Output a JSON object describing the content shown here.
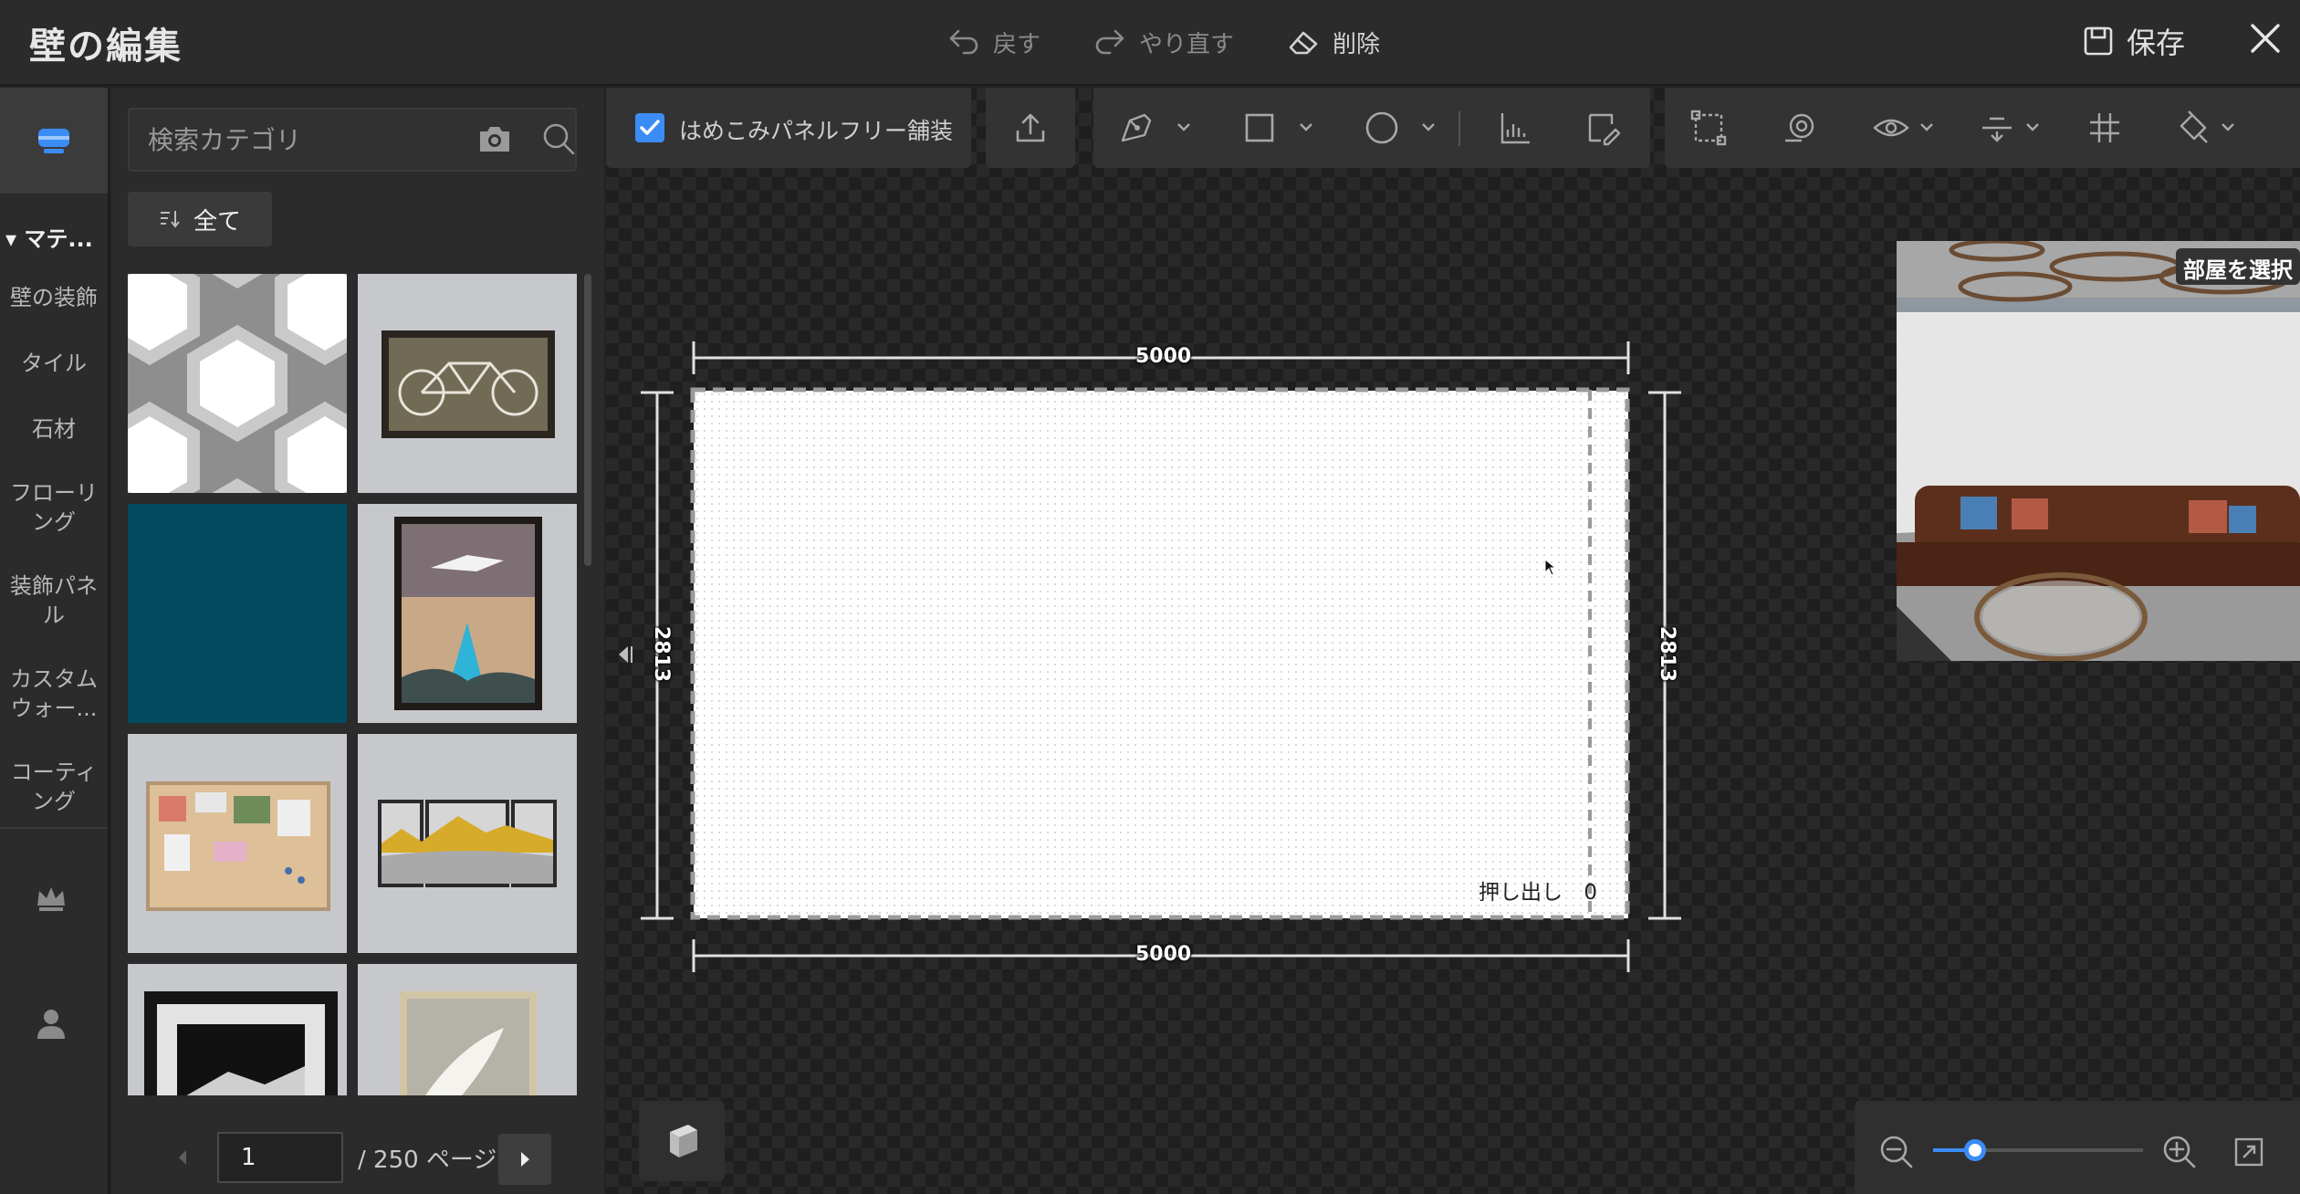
{
  "window": {
    "title": "壁の編集",
    "undo": "戻す",
    "redo": "やり直す",
    "delete": "削除",
    "save": "保存"
  },
  "rail": {
    "header": "マテ...",
    "items": [
      "壁の装飾",
      "タイル",
      "石材",
      "フローリング",
      "装飾パネル",
      "カスタムウォー...",
      "コーティング"
    ],
    "bottom_icons": [
      "crown-icon",
      "user-icon"
    ]
  },
  "panel": {
    "search_placeholder": "検索カテゴリ",
    "filter_label": "全て",
    "tiles": [
      "hexagon-tile",
      "bicycle-frame",
      "teal-solid",
      "crane-painting",
      "cork-board",
      "landscape-triptych",
      "framed-mountain",
      "feather-art"
    ],
    "pager": {
      "current": "1",
      "total_label": "/ 250 ページ"
    }
  },
  "toolbar": {
    "seamless_label": "はめこみパネルフリー舗装",
    "seamless_checked": true
  },
  "drawing": {
    "width_top": "5000",
    "width_bottom": "5000",
    "height_left": "2813",
    "height_right": "2813",
    "extrude_label": "押し出し",
    "extrude_value": "0"
  },
  "preview": {
    "label": "部屋を選択"
  },
  "zoom": {
    "level": 0.2
  },
  "colors": {
    "accent": "#3b8df5",
    "background": "#232323",
    "panel": "#2b2b2b"
  }
}
